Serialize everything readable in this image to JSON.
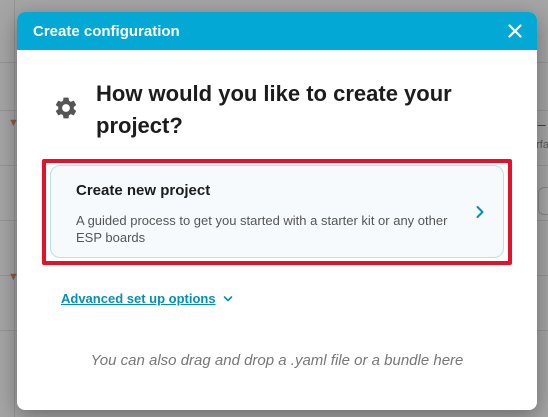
{
  "background": {
    "right_text_top": "L_",
    "right_text_sub": "erfa"
  },
  "dialog": {
    "title": "Create configuration",
    "heading": "How would you like to create your project?",
    "option": {
      "title": "Create new project",
      "description": "A guided process to get you started with a starter kit or any other ESP boards"
    },
    "advanced_label": "Advanced set up options",
    "drop_hint": "You can also drag and drop a .yaml file or a bundle here"
  },
  "icons": {
    "close": "close-icon",
    "gear": "gear-icon",
    "chevron_right": "chevron-right-icon",
    "chevron_down": "chevron-down-icon"
  },
  "colors": {
    "header": "#03a9d4",
    "accent_link": "#0390b8",
    "highlight": "#e5112b"
  }
}
